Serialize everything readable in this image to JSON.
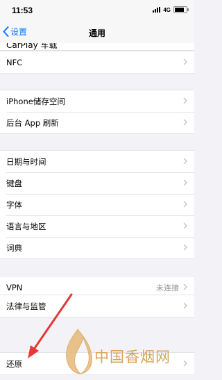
{
  "status": {
    "time": "11:53",
    "network": "4G",
    "battery_level": 0.8
  },
  "nav": {
    "back_label": "设置",
    "title": "通用"
  },
  "partial_row": {
    "label": "CarPlay 车载"
  },
  "groups": [
    {
      "rows": [
        {
          "label": "NFC"
        }
      ]
    },
    {
      "rows": [
        {
          "label": "iPhone储存空间"
        },
        {
          "label": "后台 App 刷新"
        }
      ]
    },
    {
      "rows": [
        {
          "label": "日期与时间"
        },
        {
          "label": "键盘"
        },
        {
          "label": "字体"
        },
        {
          "label": "语言与地区"
        },
        {
          "label": "词典"
        }
      ]
    },
    {
      "rows": [
        {
          "label": "VPN",
          "detail": "未连接"
        }
      ]
    },
    {
      "rows": [
        {
          "label": "法律与监管"
        }
      ]
    },
    {
      "rows": [
        {
          "label": "还原"
        }
      ]
    }
  ],
  "watermark": {
    "text": "中国香烟网"
  },
  "colors": {
    "accent": "#0a7aff",
    "annotation_arrow": "#e53935",
    "watermark": "#d8a35b",
    "background": "#f2f2f7"
  }
}
